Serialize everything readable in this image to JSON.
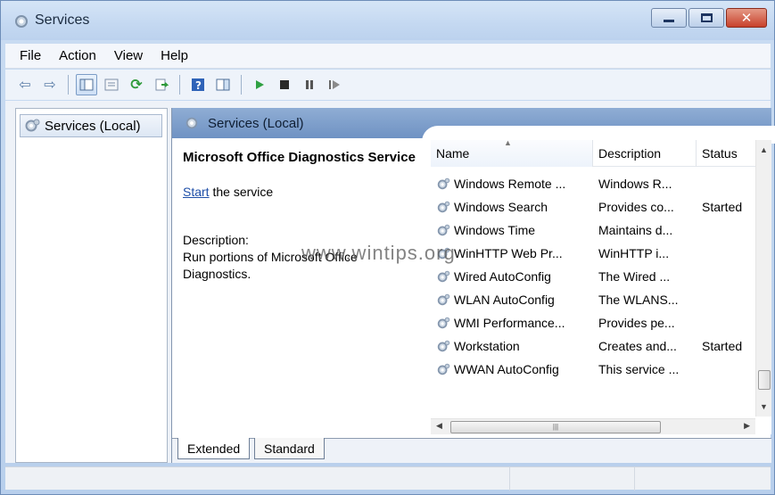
{
  "window": {
    "title": "Services"
  },
  "menu": [
    "File",
    "Action",
    "View",
    "Help"
  ],
  "tree": {
    "item": "Services (Local)"
  },
  "pane": {
    "header": "Services (Local)"
  },
  "details": {
    "service_name": "Microsoft Office Diagnostics Service",
    "start_link": "Start",
    "start_suffix": " the service",
    "desc_label": "Description:",
    "desc_text": "Run portions of Microsoft Office Diagnostics."
  },
  "list": {
    "columns": {
      "name": "Name",
      "description": "Description",
      "status": "Status"
    },
    "rows": [
      {
        "name": "Windows Remote ...",
        "description": "Windows R...",
        "status": ""
      },
      {
        "name": "Windows Search",
        "description": "Provides co...",
        "status": "Started"
      },
      {
        "name": "Windows Time",
        "description": "Maintains d...",
        "status": ""
      },
      {
        "name": "WinHTTP Web Pr...",
        "description": "WinHTTP i...",
        "status": ""
      },
      {
        "name": "Wired AutoConfig",
        "description": "The Wired ...",
        "status": ""
      },
      {
        "name": "WLAN AutoConfig",
        "description": "The WLANS...",
        "status": ""
      },
      {
        "name": "WMI Performance...",
        "description": "Provides pe...",
        "status": ""
      },
      {
        "name": "Workstation",
        "description": "Creates and...",
        "status": "Started"
      },
      {
        "name": "WWAN AutoConfig",
        "description": "This service ...",
        "status": ""
      }
    ]
  },
  "tabs": [
    "Extended",
    "Standard"
  ],
  "watermark": "www.wintips.org",
  "colors": {
    "header_blue": "#7b9acb",
    "link": "#1f4fa8",
    "close_red": "#c8412b"
  },
  "icons": {
    "title": "services-gear-icon",
    "back": "back-arrow-icon",
    "forward": "forward-arrow-icon",
    "play": "play-icon",
    "stop": "stop-icon",
    "pause": "pause-icon",
    "restart": "restart-icon"
  }
}
